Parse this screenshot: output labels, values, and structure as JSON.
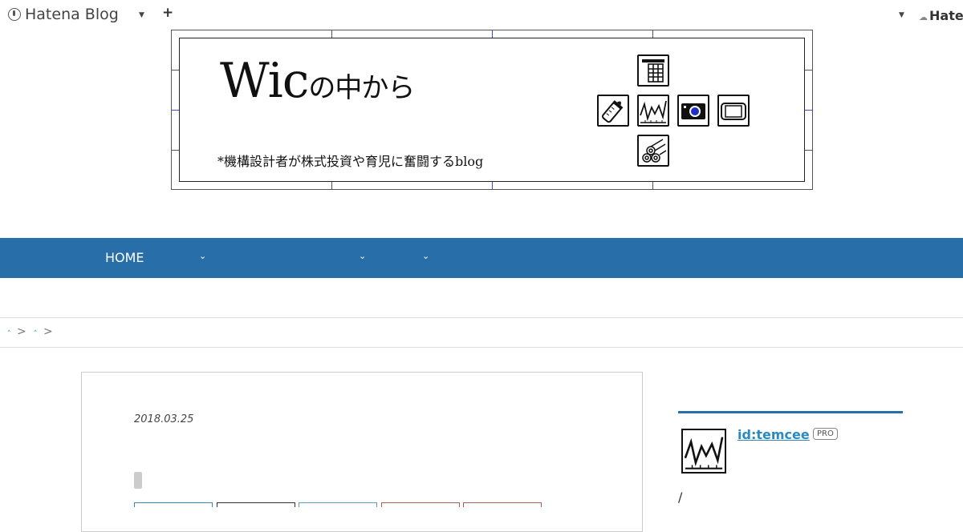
{
  "topbar": {
    "brand": "Hatena Blog",
    "add_label": "+",
    "right_label": "Hate"
  },
  "header": {
    "title_main": "Wic",
    "title_tail": "の中から",
    "description": "*機構設計者が株式投資や育児に奮闘するblog",
    "icons": [
      "calendar-icon",
      "baby-bottle-icon",
      "stock-chart-icon",
      "camera-icon",
      "smartphone-icon",
      "logs-icon"
    ]
  },
  "nav": {
    "home": "HOME",
    "dropdown_count": 3
  },
  "breadcrumb": {
    "separator": ">"
  },
  "article": {
    "date": "2018.03.25"
  },
  "sidebar": {
    "user_id": "id:temcee",
    "badge": "PRO",
    "trailing": "/"
  },
  "colors": {
    "nav_bg": "#286ea8",
    "link": "#2a8ac0",
    "share_borders": [
      "#2a8ac0",
      "#333333",
      "#5aa0c8",
      "#b05a5a",
      "#b05a5a"
    ]
  }
}
